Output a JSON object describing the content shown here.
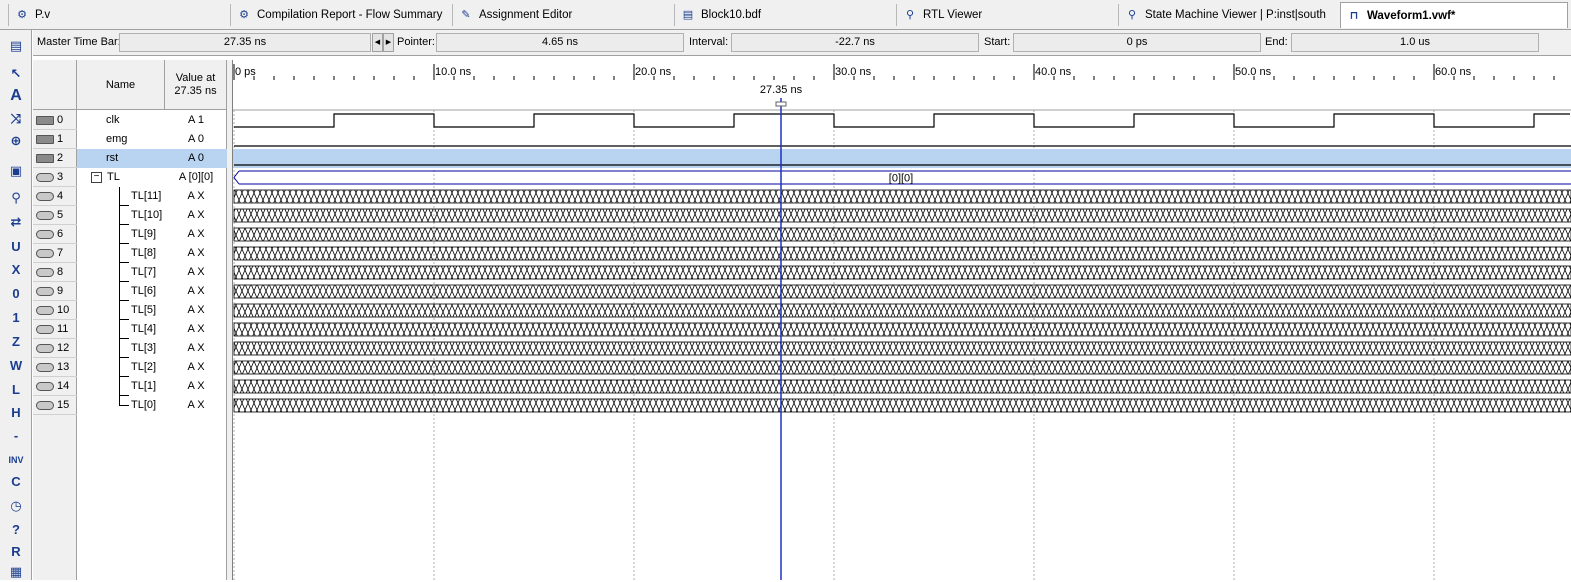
{
  "tabs": [
    {
      "label": "P.v",
      "icon": "verilog-file-icon",
      "active": false
    },
    {
      "label": "Compilation Report - Flow Summary",
      "icon": "report-icon",
      "active": false
    },
    {
      "label": "Assignment Editor",
      "icon": "assignment-icon",
      "active": false
    },
    {
      "label": "Block10.bdf",
      "icon": "block-diagram-icon",
      "active": false
    },
    {
      "label": "RTL Viewer",
      "icon": "rtl-viewer-icon",
      "active": false
    },
    {
      "label": "State Machine Viewer | P:inst|south",
      "icon": "state-machine-icon",
      "active": false
    },
    {
      "label": "Waveform1.vwf*",
      "icon": "waveform-icon",
      "active": true
    }
  ],
  "timebar": {
    "master_label": "Master Time Bar:",
    "master_value": "27.35 ns",
    "pointer_label": "Pointer:",
    "pointer_value": "4.65 ns",
    "interval_label": "Interval:",
    "interval_value": "-22.7 ns",
    "start_label": "Start:",
    "start_value": "0 ps",
    "end_label": "End:",
    "end_value": "1.0 us"
  },
  "headers": {
    "name": "Name",
    "value_line1": "Value at",
    "value_line2": "27.35 ns"
  },
  "signals": [
    {
      "index": "0",
      "name": "clk",
      "value": "A 1",
      "kind": "input",
      "wave": "clock"
    },
    {
      "index": "1",
      "name": "emg",
      "value": "A 0",
      "kind": "input",
      "wave": "low"
    },
    {
      "index": "2",
      "name": "rst",
      "value": "A 0",
      "kind": "input",
      "wave": "low",
      "selected": true
    },
    {
      "index": "3",
      "name": "TL",
      "value": "A [0][0]",
      "kind": "output-group",
      "wave": "bus",
      "bus_label": "[0][0]"
    },
    {
      "index": "4",
      "name": "TL[11]",
      "value": "A X",
      "kind": "output",
      "wave": "x"
    },
    {
      "index": "5",
      "name": "TL[10]",
      "value": "A X",
      "kind": "output",
      "wave": "x"
    },
    {
      "index": "6",
      "name": "TL[9]",
      "value": "A X",
      "kind": "output",
      "wave": "x"
    },
    {
      "index": "7",
      "name": "TL[8]",
      "value": "A X",
      "kind": "output",
      "wave": "x"
    },
    {
      "index": "8",
      "name": "TL[7]",
      "value": "A X",
      "kind": "output",
      "wave": "x"
    },
    {
      "index": "9",
      "name": "TL[6]",
      "value": "A X",
      "kind": "output",
      "wave": "x"
    },
    {
      "index": "10",
      "name": "TL[5]",
      "value": "A X",
      "kind": "output",
      "wave": "x"
    },
    {
      "index": "11",
      "name": "TL[4]",
      "value": "A X",
      "kind": "output",
      "wave": "x"
    },
    {
      "index": "12",
      "name": "TL[3]",
      "value": "A X",
      "kind": "output",
      "wave": "x"
    },
    {
      "index": "13",
      "name": "TL[2]",
      "value": "A X",
      "kind": "output",
      "wave": "x"
    },
    {
      "index": "14",
      "name": "TL[1]",
      "value": "A X",
      "kind": "output",
      "wave": "x"
    },
    {
      "index": "15",
      "name": "TL[0]",
      "value": "A X",
      "kind": "output",
      "wave": "x"
    }
  ],
  "timeline": {
    "ticks": [
      "0 ps",
      "10.0 ns",
      "20.0 ns",
      "30.0 ns",
      "40.0 ns",
      "50.0 ns",
      "60.0 ns"
    ],
    "tick_values_ns": [
      0,
      10,
      20,
      30,
      40,
      50,
      60
    ],
    "view_end_ns": 66.8,
    "cursor_ns": 27.35,
    "cursor_label": "27.35 ns",
    "clock_period_ns": 10,
    "clock_high_start_ns": 5
  },
  "colors": {
    "cursor": "#2030c0",
    "selected_row": "#b8d4f0",
    "wave": "#000000",
    "bus": "#0000a0"
  }
}
